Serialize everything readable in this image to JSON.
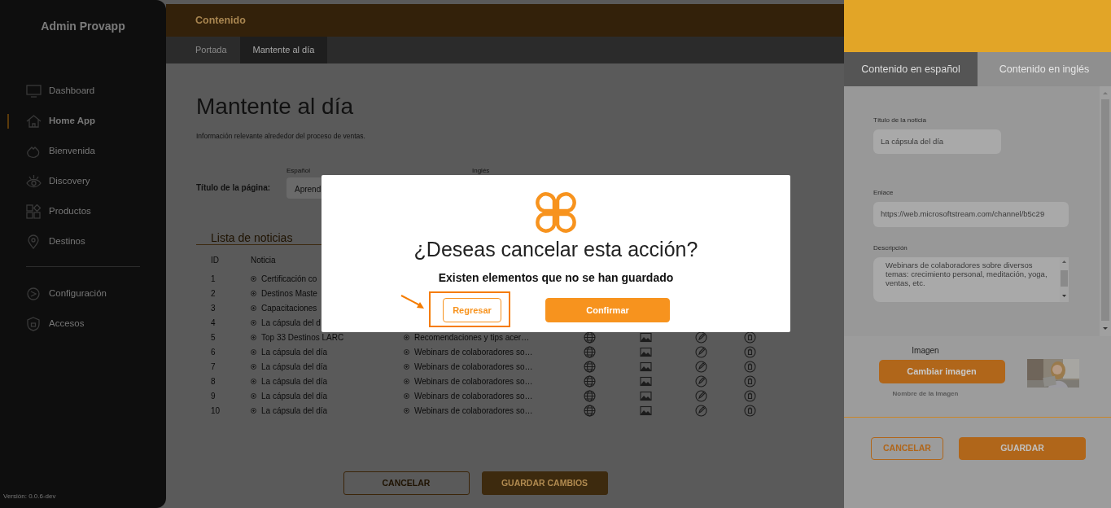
{
  "sidebar": {
    "brand": "Admin Provapp",
    "items": [
      {
        "label": "Dashboard",
        "selected": false
      },
      {
        "label": "Home App",
        "selected": true
      },
      {
        "label": "Bienvenida",
        "selected": false
      },
      {
        "label": "Discovery",
        "selected": false
      },
      {
        "label": "Productos",
        "selected": false
      },
      {
        "label": "Destinos",
        "selected": false
      }
    ],
    "footer_items": [
      {
        "label": "Configuración",
        "selected": false
      },
      {
        "label": "Accesos",
        "selected": false
      }
    ],
    "version": "Versión: 0.0.6-dev"
  },
  "header": {
    "title": "Contenido"
  },
  "subtabs": [
    {
      "label": "Portada",
      "selected": false
    },
    {
      "label": "Mantente al día",
      "selected": true
    }
  ],
  "page": {
    "title": "Mantente al día",
    "subtitle": "Información relevante alrededor del proceso de ventas.",
    "form": {
      "label": "Título de la página:",
      "columns": [
        "Español",
        "Inglés"
      ],
      "value": "Aprend"
    }
  },
  "news": {
    "title": "Lista de noticias",
    "columns": [
      "ID",
      "Noticia"
    ],
    "rows": [
      {
        "id": "1",
        "title": "Certificación co"
      },
      {
        "id": "2",
        "title": "Destinos Maste"
      },
      {
        "id": "3",
        "title": "Capacitaciones"
      },
      {
        "id": "4",
        "title": "La cápsula del d"
      },
      {
        "id": "5",
        "title": "Top 33 Destinos LARC",
        "description": "Recomendaciones y tips acer…"
      },
      {
        "id": "6",
        "title": "La cápsula del día",
        "description": "Webinars de colaboradores so…"
      },
      {
        "id": "7",
        "title": "La cápsula del día",
        "description": "Webinars de colaboradores so…"
      },
      {
        "id": "8",
        "title": "La cápsula del día",
        "description": "Webinars de colaboradores so…"
      },
      {
        "id": "9",
        "title": "La cápsula del día",
        "description": "Webinars de colaboradores so…"
      },
      {
        "id": "10",
        "title": "La cápsula del día",
        "description": "Webinars de colaboradores so…"
      }
    ]
  },
  "footer_buttons": [
    {
      "label": "CANCELAR",
      "kind": "outline"
    },
    {
      "label": "GUARDAR CAMBIOS",
      "kind": "primary"
    }
  ],
  "drawer": {
    "tabs": [
      {
        "label": "Contenido en español",
        "selected": true
      },
      {
        "label": "Contenido en inglés",
        "selected": false
      }
    ],
    "fields": [
      {
        "kind": "input",
        "label": "Título de la noticia",
        "value": "La cápsula del día"
      },
      {
        "kind": "input",
        "label": "Enlace",
        "value": "https://web.microsoftstream.com/channel/b5c29"
      },
      {
        "kind": "textarea",
        "label": "Descripción",
        "value": "Webinars de colaboradores sobre diversos temas: crecimiento personal, meditación, yoga, ventas, etc."
      }
    ],
    "image": {
      "label": "Imagen",
      "button": "Cambiar imagen",
      "file_name": "Nombre de la Imagen"
    },
    "buttons": [
      {
        "label": "CANCELAR",
        "kind": "outline"
      },
      {
        "label": "GUARDAR",
        "kind": "primary"
      }
    ]
  },
  "modal": {
    "title": "¿Deseas cancelar esta acción?",
    "message": "Existen elementos que no se han guardado",
    "buttons": [
      {
        "label": "Regresar",
        "kind": "outline",
        "highlighted": true
      },
      {
        "label": "Confirmar",
        "kind": "primary",
        "highlighted": false
      }
    ]
  }
}
